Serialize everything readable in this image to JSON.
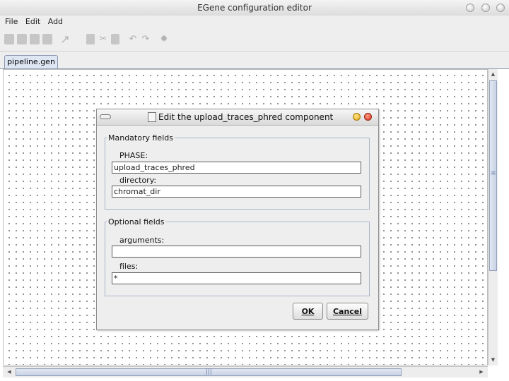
{
  "window": {
    "title": "EGene configuration editor"
  },
  "menu": {
    "file": "File",
    "edit": "Edit",
    "add": "Add"
  },
  "tabs": [
    {
      "label": "pipeline.gen"
    }
  ],
  "dialog": {
    "title": "Edit the upload_traces_phred component",
    "mandatory": {
      "legend": "Mandatory fields",
      "phase": {
        "label": "PHASE:",
        "value": "upload_traces_phred"
      },
      "directory": {
        "label": "directory:",
        "value": "chromat_dir"
      }
    },
    "optional": {
      "legend": "Optional fields",
      "arguments": {
        "label": "arguments:",
        "value": ""
      },
      "files": {
        "label": "files:",
        "value": "*"
      }
    },
    "ok_label": "OK",
    "cancel_label": "Cancel"
  },
  "colors": {
    "accent": "#8a96b0",
    "scroll_thumb": "#c7d2e6"
  }
}
